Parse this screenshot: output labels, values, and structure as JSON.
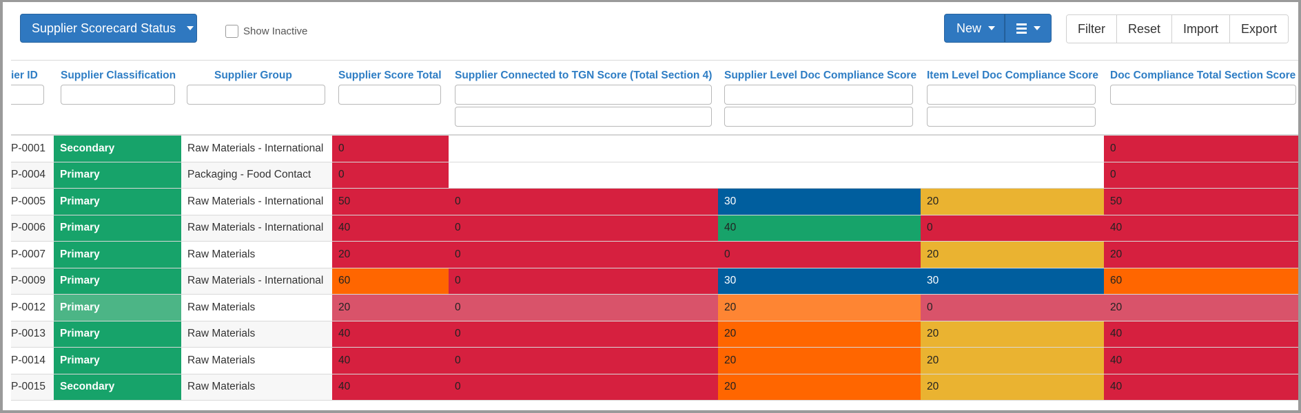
{
  "toolbar": {
    "status_button": "Supplier Scorecard Status",
    "show_inactive": "Show Inactive",
    "new_button": "New",
    "buttons": [
      "Filter",
      "Reset",
      "Import",
      "Export"
    ]
  },
  "icons": {
    "dropdown": "caret-down-icon",
    "menu": "hamburger-menu-icon",
    "checkbox": "checkbox-unchecked-icon"
  },
  "columns": [
    "ier ID",
    "Supplier Classification",
    "Supplier Group",
    "Supplier Score Total",
    "Supplier Connected to TGN Score (Total Section 4)",
    "Supplier Level Doc Compliance Score",
    "Item Level Doc Compliance Score",
    "Doc Compliance Total Section Score"
  ],
  "colors": {
    "red": "#d6203f",
    "green": "#17a36a",
    "orange": "#ff6600",
    "blue": "#005e9e",
    "yellow": "#eab331",
    "red_faded": "#d9536a",
    "green_faded": "#4cb586",
    "orange_faded": "#fe8533",
    "link_blue": "#2e7dc4"
  },
  "rows": [
    {
      "id": "P-0001",
      "cls": "Secondary",
      "group": "Raw Materials - International",
      "total": {
        "v": "0",
        "c": "red"
      },
      "tgn": null,
      "sup": null,
      "item": null,
      "doc": {
        "v": "0",
        "c": "red"
      }
    },
    {
      "id": "P-0004",
      "cls": "Primary",
      "group": "Packaging - Food Contact",
      "total": {
        "v": "0",
        "c": "red"
      },
      "tgn": null,
      "sup": null,
      "item": null,
      "doc": {
        "v": "0",
        "c": "red"
      }
    },
    {
      "id": "P-0005",
      "cls": "Primary",
      "group": "Raw Materials - International",
      "total": {
        "v": "50",
        "c": "red"
      },
      "tgn": {
        "v": "0",
        "c": "red"
      },
      "sup": {
        "v": "30",
        "c": "blue"
      },
      "item": {
        "v": "20",
        "c": "yellow"
      },
      "doc": {
        "v": "50",
        "c": "red"
      }
    },
    {
      "id": "P-0006",
      "cls": "Primary",
      "group": "Raw Materials - International",
      "total": {
        "v": "40",
        "c": "red"
      },
      "tgn": {
        "v": "0",
        "c": "red"
      },
      "sup": {
        "v": "40",
        "c": "green"
      },
      "item": {
        "v": "0",
        "c": "red"
      },
      "doc": {
        "v": "40",
        "c": "red"
      }
    },
    {
      "id": "P-0007",
      "cls": "Primary",
      "group": "Raw Materials",
      "total": {
        "v": "20",
        "c": "red"
      },
      "tgn": {
        "v": "0",
        "c": "red"
      },
      "sup": {
        "v": "0",
        "c": "red"
      },
      "item": {
        "v": "20",
        "c": "yellow"
      },
      "doc": {
        "v": "20",
        "c": "red"
      }
    },
    {
      "id": "P-0009",
      "cls": "Primary",
      "group": "Raw Materials - International",
      "total": {
        "v": "60",
        "c": "orange"
      },
      "tgn": {
        "v": "0",
        "c": "red"
      },
      "sup": {
        "v": "30",
        "c": "blue"
      },
      "item": {
        "v": "30",
        "c": "blue"
      },
      "doc": {
        "v": "60",
        "c": "orange"
      }
    },
    {
      "id": "P-0012",
      "cls": "Primary",
      "group": "Raw Materials",
      "faded": true,
      "total": {
        "v": "20",
        "c": "red"
      },
      "tgn": {
        "v": "0",
        "c": "red"
      },
      "sup": {
        "v": "20",
        "c": "orange"
      },
      "item": {
        "v": "0",
        "c": "red"
      },
      "doc": {
        "v": "20",
        "c": "red"
      }
    },
    {
      "id": "P-0013",
      "cls": "Primary",
      "group": "Raw Materials",
      "total": {
        "v": "40",
        "c": "red"
      },
      "tgn": {
        "v": "0",
        "c": "red"
      },
      "sup": {
        "v": "20",
        "c": "orange"
      },
      "item": {
        "v": "20",
        "c": "yellow"
      },
      "doc": {
        "v": "40",
        "c": "red"
      }
    },
    {
      "id": "P-0014",
      "cls": "Primary",
      "group": "Raw Materials",
      "total": {
        "v": "40",
        "c": "red"
      },
      "tgn": {
        "v": "0",
        "c": "red"
      },
      "sup": {
        "v": "20",
        "c": "orange"
      },
      "item": {
        "v": "20",
        "c": "yellow"
      },
      "doc": {
        "v": "40",
        "c": "red"
      }
    },
    {
      "id": "P-0015",
      "cls": "Secondary",
      "group": "Raw Materials",
      "total": {
        "v": "40",
        "c": "red"
      },
      "tgn": {
        "v": "0",
        "c": "red"
      },
      "sup": {
        "v": "20",
        "c": "orange"
      },
      "item": {
        "v": "20",
        "c": "yellow"
      },
      "doc": {
        "v": "40",
        "c": "red"
      }
    }
  ]
}
